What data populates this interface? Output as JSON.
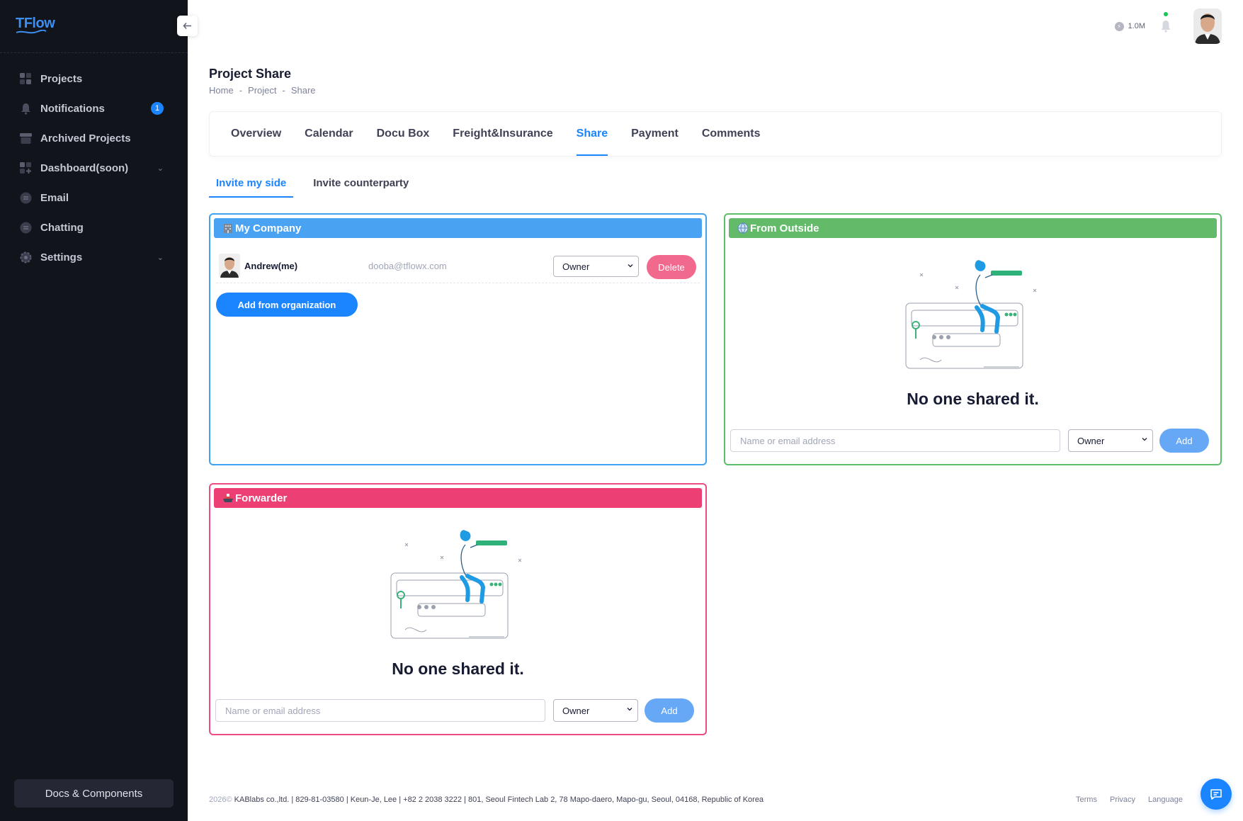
{
  "app": {
    "logo": "TFlow",
    "docs_button": "Docs & Components"
  },
  "sidebar": {
    "items": [
      {
        "label": "Projects",
        "icon": "grid-icon"
      },
      {
        "label": "Notifications",
        "icon": "bell-icon",
        "badge": "1"
      },
      {
        "label": "Archived Projects",
        "icon": "archive-icon"
      },
      {
        "label": "Dashboard(soon)",
        "icon": "dashboard-icon",
        "expandable": true
      },
      {
        "label": "Email",
        "icon": "message-icon"
      },
      {
        "label": "Chatting",
        "icon": "chat-icon"
      },
      {
        "label": "Settings",
        "icon": "gear-icon",
        "expandable": true
      }
    ]
  },
  "header": {
    "credit": "1.0M"
  },
  "page": {
    "title": "Project Share",
    "breadcrumb": [
      "Home",
      "Project",
      "Share"
    ],
    "breadcrumb_sep": "-"
  },
  "tabs": [
    "Overview",
    "Calendar",
    "Docu Box",
    "Freight&Insurance",
    "Share",
    "Payment",
    "Comments"
  ],
  "active_tab": "Share",
  "subtabs": [
    "Invite my side",
    "Invite counterparty"
  ],
  "active_subtab": "Invite my side",
  "panels": {
    "company": {
      "title": "My Company",
      "member": {
        "name": "Andrew(me)",
        "email": "dooba@tflowx.com",
        "role": "Owner",
        "delete_label": "Delete"
      },
      "add_button": "Add from organization"
    },
    "outside": {
      "title": "From Outside",
      "empty_text": "No one shared it.",
      "input_placeholder": "Name or email address",
      "role": "Owner",
      "add_button": "Add"
    },
    "forwarder": {
      "title": "Forwarder",
      "empty_text": "No one shared it.",
      "input_placeholder": "Name or email address",
      "role": "Owner",
      "add_button": "Add"
    }
  },
  "footer": {
    "year": "2026©",
    "text": "KABlabs co.,ltd. | 829-81-03580 | Keun-Je, Lee | +82 2 2038 3222 | 801, Seoul Fintech Lab 2, 78 Mapo-daero, Mapo-gu, Seoul, 04168, Republic of Korea",
    "links": [
      "Terms",
      "Privacy",
      "Language"
    ]
  },
  "colors": {
    "accent": "#1b84ff",
    "company": "#4aa3f2",
    "outside": "#63bb6a",
    "forwarder": "#ec3f73"
  }
}
